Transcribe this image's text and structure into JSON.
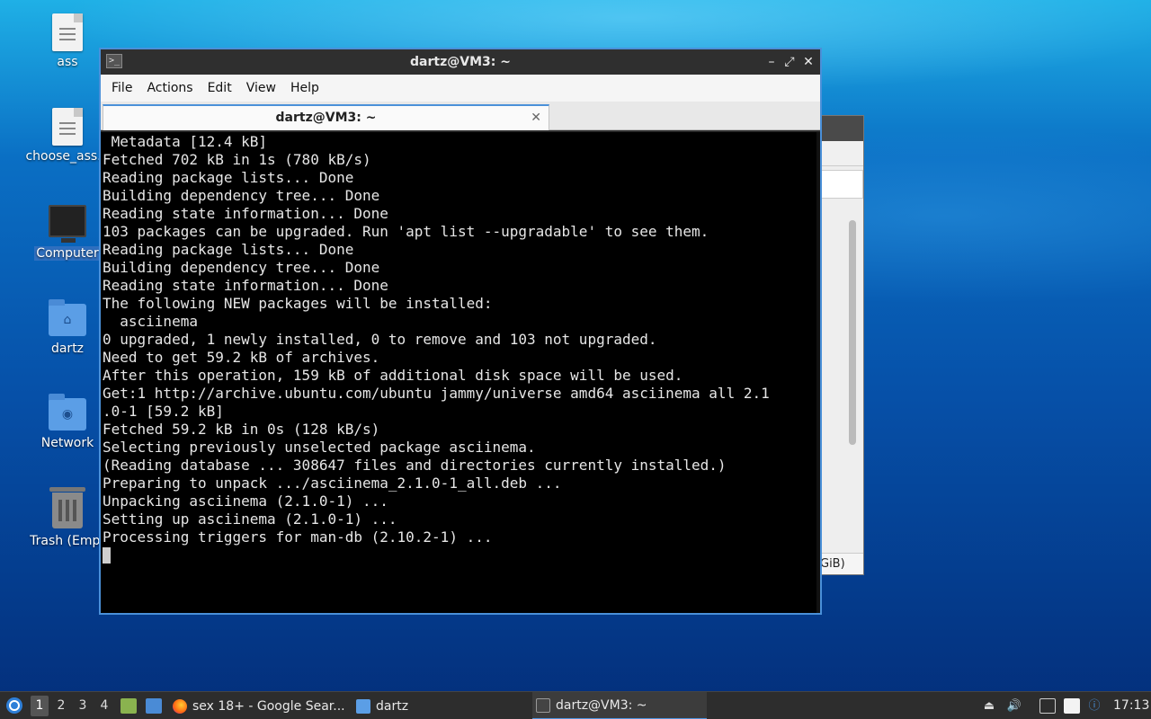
{
  "desktop": {
    "icons": [
      {
        "label": "ass"
      },
      {
        "label": "choose_ass.p"
      },
      {
        "label": "Computer"
      },
      {
        "label": "dartz"
      },
      {
        "label": "Network"
      },
      {
        "label": "Trash (Empt"
      }
    ]
  },
  "background_window": {
    "footer_text": "GiB)"
  },
  "terminal_window": {
    "title": "dartz@VM3: ~",
    "controls": {
      "minimize": "–",
      "maximize": "⤢",
      "close": "✕"
    },
    "menu": [
      "File",
      "Actions",
      "Edit",
      "View",
      "Help"
    ],
    "tab": {
      "label": "dartz@VM3: ~",
      "close": "✕"
    },
    "lines": [
      " Metadata [12.4 kB]",
      "Fetched 702 kB in 1s (780 kB/s)",
      "Reading package lists... Done",
      "Building dependency tree... Done",
      "Reading state information... Done",
      "103 packages can be upgraded. Run 'apt list --upgradable' to see them.",
      "Reading package lists... Done",
      "Building dependency tree... Done",
      "Reading state information... Done",
      "The following NEW packages will be installed:",
      "  asciinema",
      "0 upgraded, 1 newly installed, 0 to remove and 103 not upgraded.",
      "Need to get 59.2 kB of archives.",
      "After this operation, 159 kB of additional disk space will be used.",
      "Get:1 http://archive.ubuntu.com/ubuntu jammy/universe amd64 asciinema all 2.1",
      ".0-1 [59.2 kB]",
      "Fetched 59.2 kB in 0s (128 kB/s)",
      "Selecting previously unselected package asciinema.",
      "(Reading database ... 308647 files and directories currently installed.)",
      "Preparing to unpack .../asciinema_2.1.0-1_all.deb ...",
      "Unpacking asciinema (2.1.0-1) ...",
      "Setting up asciinema (2.1.0-1) ...",
      "Processing triggers for man-db (2.10.2-1) ..."
    ]
  },
  "taskbar": {
    "workspaces": [
      "1",
      "2",
      "3",
      "4"
    ],
    "tasks": [
      {
        "label": "sex 18+ - Google Sear..."
      },
      {
        "label": "dartz"
      },
      {
        "label": "dartz@VM3: ~"
      }
    ],
    "clock": "17:13"
  },
  "colors": {
    "accent": "#4a90d9",
    "terminal_bg": "#000000",
    "terminal_fg": "#e6e6e6",
    "taskbar_bg": "#2d2d2d"
  }
}
